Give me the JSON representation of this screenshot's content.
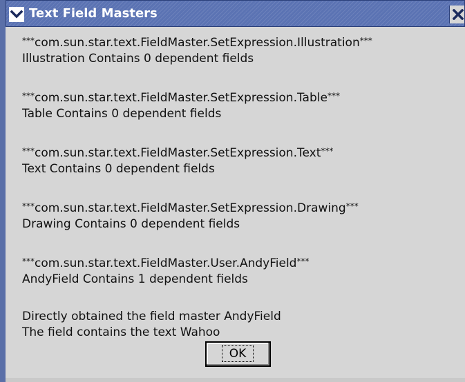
{
  "window": {
    "title": "Text Field Masters",
    "accent_color": "#5b73b3",
    "menu_icon": "chevron-down-icon",
    "close_icon": "close-icon"
  },
  "messages": [
    {
      "header": "com.sun.star.text.FieldMaster.SetExpression.Illustration",
      "detail": "Illustration Contains 0 dependent fields"
    },
    {
      "header": "com.sun.star.text.FieldMaster.SetExpression.Table",
      "detail": "Table Contains 0 dependent fields"
    },
    {
      "header": "com.sun.star.text.FieldMaster.SetExpression.Text",
      "detail": "Text Contains 0 dependent fields"
    },
    {
      "header": "com.sun.star.text.FieldMaster.SetExpression.Drawing",
      "detail": "Drawing Contains 0 dependent fields"
    },
    {
      "header": "com.sun.star.text.FieldMaster.User.AndyField",
      "detail": "AndyField Contains 1 dependent fields"
    }
  ],
  "stars": "***",
  "summary": {
    "line1": "Directly obtained the field master AndyField",
    "line2": "The field contains the text Wahoo"
  },
  "buttons": {
    "ok_label": "OK"
  }
}
